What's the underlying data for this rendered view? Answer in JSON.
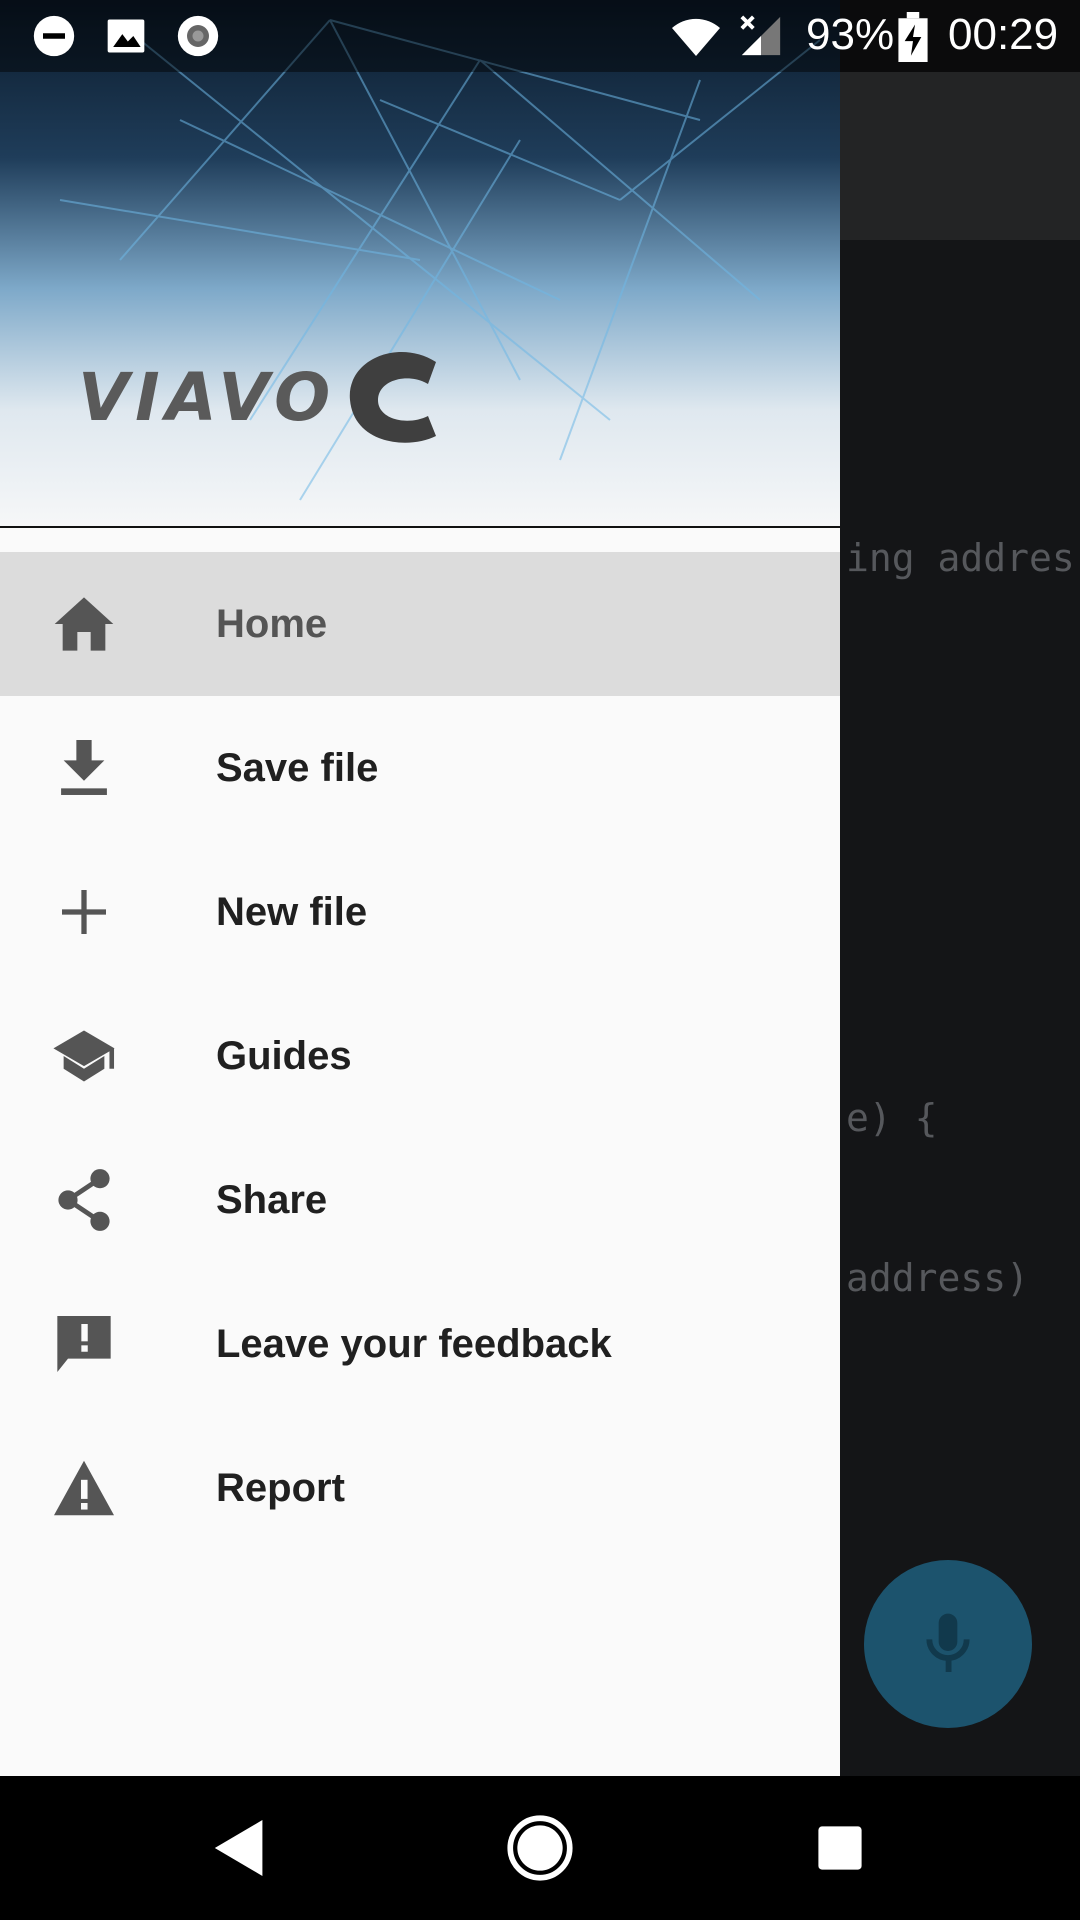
{
  "status_bar": {
    "battery": "93%",
    "time": "00:29",
    "icons": [
      "do-not-disturb-icon",
      "image-icon",
      "sync-icon",
      "wifi-icon",
      "signal-icon",
      "battery-charging-icon"
    ]
  },
  "header": {
    "logo_text": "VIAVOC"
  },
  "menu": {
    "items": [
      {
        "label": "Home",
        "icon": "home-icon",
        "active": true
      },
      {
        "label": "Save file",
        "icon": "download-icon"
      },
      {
        "label": "New file",
        "icon": "plus-icon"
      },
      {
        "label": "Guides",
        "icon": "school-icon"
      },
      {
        "label": "Share",
        "icon": "share-icon"
      },
      {
        "label": "Leave your feedback",
        "icon": "feedback-icon"
      },
      {
        "label": "Report",
        "icon": "warning-icon"
      }
    ]
  },
  "background_code": {
    "line1": "ing addres",
    "line2": "e) {",
    "line3": "address) "
  },
  "fab": {
    "icon": "microphone-icon",
    "color": "#1c536d"
  },
  "colors": {
    "drawer_bg": "#fafafa",
    "active_item_bg": "#dcdcdc",
    "editor_bg": "#141517"
  }
}
